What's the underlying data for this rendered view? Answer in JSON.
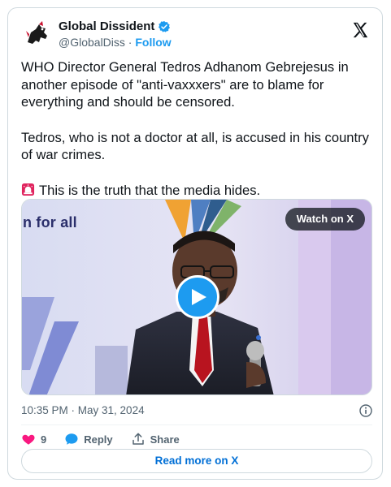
{
  "author": {
    "display_name": "Global Dissident",
    "handle": "@GlobalDiss",
    "separator": "·",
    "follow_label": "Follow"
  },
  "tweet": {
    "paragraph_1": "WHO Director General Tedros Adhanom Gebrejesus in another episode of \"anti-vaxxxers\" are to blame for everything and should be censored.",
    "paragraph_2": "Tedros, who is not a doctor at all, is accused in his country of war crimes.",
    "paragraph_3": "This is the truth that the media hides.",
    "emoji": "rotating-light-emoji"
  },
  "media": {
    "banner_text": "n for all",
    "watch_label": "Watch on X"
  },
  "meta": {
    "timestamp": "10:35 PM · May 31, 2024"
  },
  "actions": {
    "like_count": "9",
    "reply_label": "Reply",
    "share_label": "Share"
  },
  "read_more_label": "Read more on X",
  "colors": {
    "accent": "#1d9bf0",
    "like": "#f91880",
    "link": "#006fd6",
    "text_secondary": "#536471"
  }
}
